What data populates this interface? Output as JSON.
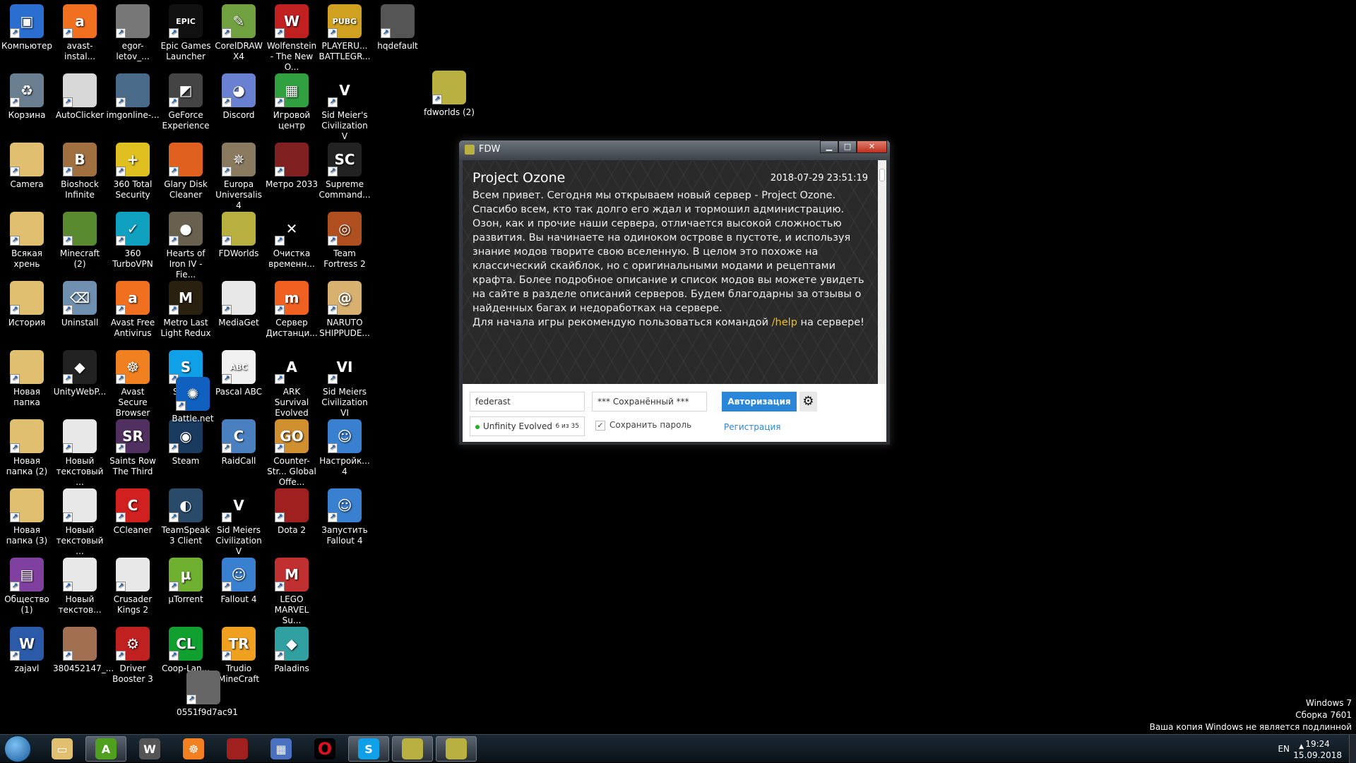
{
  "desktop": {
    "columns": [
      [
        {
          "label": "Компьютер",
          "icon": "computer-icon",
          "color": "#2a6fd0",
          "glyph": "▣"
        },
        {
          "label": "Корзина",
          "icon": "recycle-bin-icon",
          "color": "#6a8090",
          "glyph": "♻"
        },
        {
          "label": "Camera",
          "icon": "folder-icon",
          "color": "#e0c070",
          "glyph": ""
        },
        {
          "label": "Всякая хрень",
          "icon": "folder-icon",
          "color": "#e0c070",
          "glyph": ""
        },
        {
          "label": "История",
          "icon": "folder-icon",
          "color": "#e0c070",
          "glyph": ""
        },
        {
          "label": "Новая папка",
          "icon": "folder-icon",
          "color": "#e0c070",
          "glyph": ""
        },
        {
          "label": "Новая папка (2)",
          "icon": "folder-icon",
          "color": "#e0c070",
          "glyph": ""
        },
        {
          "label": "Новая папка (3)",
          "icon": "folder-icon",
          "color": "#e0c070",
          "glyph": ""
        },
        {
          "label": "Общество (1)",
          "icon": "winrar-icon",
          "color": "#8040a0",
          "glyph": "▤"
        },
        {
          "label": "zajavl",
          "icon": "word-document-icon",
          "color": "#2a5aa8",
          "glyph": "W"
        }
      ],
      [
        {
          "label": "avast-instal...",
          "icon": "avast-icon",
          "color": "#f07020",
          "glyph": "a"
        },
        {
          "label": "AutoClicker",
          "icon": "autoclicker-icon",
          "color": "#d8d8d8",
          "glyph": ""
        },
        {
          "label": "Bioshock Infinite",
          "icon": "bioshock-icon",
          "color": "#a07040",
          "glyph": "B"
        },
        {
          "label": "Minecraft (2)",
          "icon": "minecraft-icon",
          "color": "#5a8a30",
          "glyph": ""
        },
        {
          "label": "Uninstall",
          "icon": "uninstall-icon",
          "color": "#7090b0",
          "glyph": "⌫"
        },
        {
          "label": "UnityWebP...",
          "icon": "unity-icon",
          "color": "#222",
          "glyph": "◆"
        },
        {
          "label": "Новый текстовый ...",
          "icon": "text-file-icon",
          "color": "#e8e8e8",
          "glyph": ""
        },
        {
          "label": "Новый текстовый ...",
          "icon": "text-file-icon",
          "color": "#e8e8e8",
          "glyph": ""
        },
        {
          "label": "Новый текстов...",
          "icon": "text-file-icon",
          "color": "#e8e8e8",
          "glyph": ""
        },
        {
          "label": "380452147_...",
          "icon": "image-file-icon",
          "color": "#a07050",
          "glyph": ""
        }
      ],
      [
        {
          "label": "egor-letov_...",
          "icon": "image-file-icon",
          "color": "#777",
          "glyph": ""
        },
        {
          "label": "imgonline-...",
          "icon": "image-file-icon",
          "color": "#4a6a8a",
          "glyph": ""
        },
        {
          "label": "360 Total Security",
          "icon": "360-security-icon",
          "color": "#e0c020",
          "glyph": "+"
        },
        {
          "label": "360 TurboVPN",
          "icon": "turbovpn-icon",
          "color": "#10a0c0",
          "glyph": "✓"
        },
        {
          "label": "Avast Free Antivirus",
          "icon": "avast-icon",
          "color": "#f07020",
          "glyph": "a"
        },
        {
          "label": "Avast Secure Browser",
          "icon": "avast-browser-icon",
          "color": "#f08020",
          "glyph": "☸"
        },
        {
          "label": "Saints Row The Third",
          "icon": "saints-row-icon",
          "color": "#503060",
          "glyph": "SR"
        },
        {
          "label": "CCleaner",
          "icon": "ccleaner-icon",
          "color": "#d02020",
          "glyph": "C"
        },
        {
          "label": "Crusader Kings 2",
          "icon": "crusader-kings-icon",
          "color": "#e8e8e8",
          "glyph": ""
        },
        {
          "label": "Driver Booster 3",
          "icon": "driver-booster-icon",
          "color": "#c02020",
          "glyph": "⚙"
        }
      ],
      [
        {
          "label": "Epic Games Launcher",
          "icon": "epic-games-icon",
          "color": "#111",
          "glyph": "EPIC"
        },
        {
          "label": "GeForce Experience",
          "icon": "geforce-icon",
          "color": "#444",
          "glyph": "◩"
        },
        {
          "label": "Glary Disk Cleaner",
          "icon": "glary-icon",
          "color": "#e06020",
          "glyph": ""
        },
        {
          "label": "Hearts of Iron IV - Fie...",
          "icon": "hoi4-icon",
          "color": "#6a6050",
          "glyph": "●"
        },
        {
          "label": "Metro Last Light Redux",
          "icon": "metro-icon",
          "color": "#2a2010",
          "glyph": "M"
        },
        {
          "label": "Skype",
          "icon": "skype-icon",
          "color": "#10a0e8",
          "glyph": "S"
        },
        {
          "label": "Steam",
          "icon": "steam-icon",
          "color": "#1a3a60",
          "glyph": "◉"
        },
        {
          "label": "TeamSpeak 3 Client",
          "icon": "teamspeak-icon",
          "color": "#2a4a6a",
          "glyph": "◐"
        },
        {
          "label": "µTorrent",
          "icon": "utorrent-icon",
          "color": "#70b030",
          "glyph": "µ"
        },
        {
          "label": "Coop-Lan...",
          "icon": "cooplan-icon",
          "color": "#10a030",
          "glyph": "CL"
        }
      ],
      [
        {
          "label": "CorelDRAW X4",
          "icon": "coreldraw-icon",
          "color": "#70a040",
          "glyph": "✎"
        },
        {
          "label": "Discord",
          "icon": "discord-icon",
          "color": "#6a80d0",
          "glyph": "◕"
        },
        {
          "label": "Europa Universalis 4",
          "icon": "eu4-icon",
          "color": "#8a7a60",
          "glyph": "✵"
        },
        {
          "label": "FDWorlds",
          "icon": "fdworlds-icon",
          "color": "#b8b040",
          "glyph": ""
        },
        {
          "label": "MediaGet",
          "icon": "mediaget-icon",
          "color": "#e8e8e8",
          "glyph": ""
        },
        {
          "label": "Pascal ABC",
          "icon": "pascal-abc-icon",
          "color": "#f0f0f0",
          "glyph": "ABC"
        },
        {
          "label": "RaidCall",
          "icon": "raidcall-icon",
          "color": "#4a80c0",
          "glyph": "C"
        },
        {
          "label": "Sid Meiers Civilization V",
          "icon": "civ5-icon",
          "color": "#000",
          "glyph": "V"
        },
        {
          "label": "Fallout 4",
          "icon": "fallout-icon",
          "color": "#3a80d0",
          "glyph": "☺"
        },
        {
          "label": "Trudio MineCraft",
          "icon": "trudio-icon",
          "color": "#f0a020",
          "glyph": "TR"
        }
      ],
      [
        {
          "label": "Wolfenstein - The New O...",
          "icon": "wolfenstein-icon",
          "color": "#c02020",
          "glyph": "W"
        },
        {
          "label": "Игровой центр",
          "icon": "game-center-icon",
          "color": "#30a040",
          "glyph": "▦"
        },
        {
          "label": "Метро 2033",
          "icon": "metro2033-icon",
          "color": "#802020",
          "glyph": ""
        },
        {
          "label": "Очистка временн...",
          "icon": "broom-icon",
          "color": "#000",
          "glyph": "✕"
        },
        {
          "label": "Сервер Дистанци...",
          "icon": "server-icon",
          "color": "#f06020",
          "glyph": "m"
        },
        {
          "label": "ARK Survival Evolved",
          "icon": "ark-icon",
          "color": "#000",
          "glyph": "A"
        },
        {
          "label": "Counter-Str... Global Offe...",
          "icon": "csgo-icon",
          "color": "#d09030",
          "glyph": "GO"
        },
        {
          "label": "Dota 2",
          "icon": "dota2-icon",
          "color": "#a02020",
          "glyph": ""
        },
        {
          "label": "LEGO MARVEL Su...",
          "icon": "lego-marvel-icon",
          "color": "#c03030",
          "glyph": "M"
        },
        {
          "label": "Paladins",
          "icon": "paladins-icon",
          "color": "#30a0a0",
          "glyph": "◆"
        }
      ],
      [
        {
          "label": "PLAYERU... BATTLEGR...",
          "icon": "pubg-icon",
          "color": "#d0a020",
          "glyph": "PUBG"
        },
        {
          "label": "Sid Meier's Civilization V",
          "icon": "civ5-icon",
          "color": "#000",
          "glyph": "V"
        },
        {
          "label": "Supreme Command...",
          "icon": "supreme-commander-icon",
          "color": "#222",
          "glyph": "SC"
        },
        {
          "label": "Team Fortress 2",
          "icon": "tf2-icon",
          "color": "#b05020",
          "glyph": "◎"
        },
        {
          "label": "NARUTO SHIPPUDE...",
          "icon": "naruto-icon",
          "color": "#d8b070",
          "glyph": "@"
        },
        {
          "label": "Sid Meiers Civilization VI",
          "icon": "civ6-icon",
          "color": "#000",
          "glyph": "VI"
        },
        {
          "label": "Настройк... 4",
          "icon": "fallout-icon",
          "color": "#3a80d0",
          "glyph": "☺"
        },
        {
          "label": "Запустить Fallout 4",
          "icon": "fallout-icon",
          "color": "#3a80d0",
          "glyph": "☺"
        }
      ],
      [
        {
          "label": "hqdefault",
          "icon": "image-file-icon",
          "color": "#555",
          "glyph": ""
        }
      ]
    ],
    "extras": [
      {
        "label": "Battle.net",
        "icon": "battlenet-icon",
        "color": "#1060c0",
        "glyph": "✺"
      },
      {
        "label": "0551f9d7ac91",
        "icon": "image-file-icon",
        "color": "#666",
        "glyph": ""
      },
      {
        "label": "fdworlds (2)",
        "icon": "fdworlds-icon",
        "color": "#b8b040",
        "glyph": ""
      }
    ]
  },
  "window": {
    "title": "FDW",
    "news": {
      "title": "Project Ozone",
      "date": "2018-07-29 23:51:19",
      "body": "Всем привет. Сегодня мы открываем новый сервер - Project Ozone. Спасибо всем, кто так долго его ждал и тормошил администрацию. Озон, как и прочие наши сервера, отличается высокой сложностью развития. Вы начинаете на одиноком острове в пустоте, и используя знание модов творите свою вселенную. В целом это похоже на классический скайблок, но с оригинальными модами и рецептами крафта. Более подробное описание и список модов вы можете увидеть на сайте в разделе описаний серверов. Будем благодарны за отзывы о найденных багах и недоработках на сервере.",
      "line2_before": "Для начала игры рекомендую пользоваться командой ",
      "command": "/help",
      "line2_after": " на сервере!",
      "highlight_color": "#f0c020"
    },
    "login": {
      "username": "federast",
      "password": "*** Сохранённый ***",
      "auth_button": "Авторизация",
      "server_name": "Unfinity Evolved",
      "server_online": "6 из 35",
      "remember_label": "Сохранить пароль",
      "remember_checked": true,
      "register_link": "Регистрация",
      "accent": "#2a86d8"
    }
  },
  "watermark": {
    "line1": "Windows 7",
    "line2": "Сборка 7601",
    "line3": "Ваша копия Windows не является подлинной"
  },
  "taskbar": {
    "items": [
      {
        "name": "explorer",
        "icon": "folder-icon",
        "color": "#e0c070",
        "glyph": "▭",
        "active": false
      },
      {
        "name": "android-emulator",
        "icon": "green-a-icon",
        "color": "#50a020",
        "glyph": "A",
        "active": true
      },
      {
        "name": "wargaming",
        "icon": "wargaming-icon",
        "color": "#555",
        "glyph": "W",
        "active": false
      },
      {
        "name": "avast-browser",
        "icon": "avast-browser-icon",
        "color": "#f08020",
        "glyph": "☸",
        "active": false
      },
      {
        "name": "dota2",
        "icon": "dota2-icon",
        "color": "#a02020",
        "glyph": "",
        "active": false
      },
      {
        "name": "control-panel",
        "icon": "control-panel-icon",
        "color": "#4a70c0",
        "glyph": "▦",
        "active": false
      },
      {
        "name": "opera",
        "icon": "opera-icon",
        "color": "#000",
        "glyph": "O",
        "active": false
      },
      {
        "name": "skype",
        "icon": "skype-icon",
        "color": "#10a0e8",
        "glyph": "S",
        "active": true
      },
      {
        "name": "fdworlds",
        "icon": "fdworlds-icon",
        "color": "#b8b040",
        "glyph": "",
        "active": true
      },
      {
        "name": "fdw",
        "icon": "fdworlds-icon",
        "color": "#b8b040",
        "glyph": "",
        "active": true
      }
    ],
    "lang": "EN",
    "time": "19:24",
    "date": "15.09.2018"
  }
}
